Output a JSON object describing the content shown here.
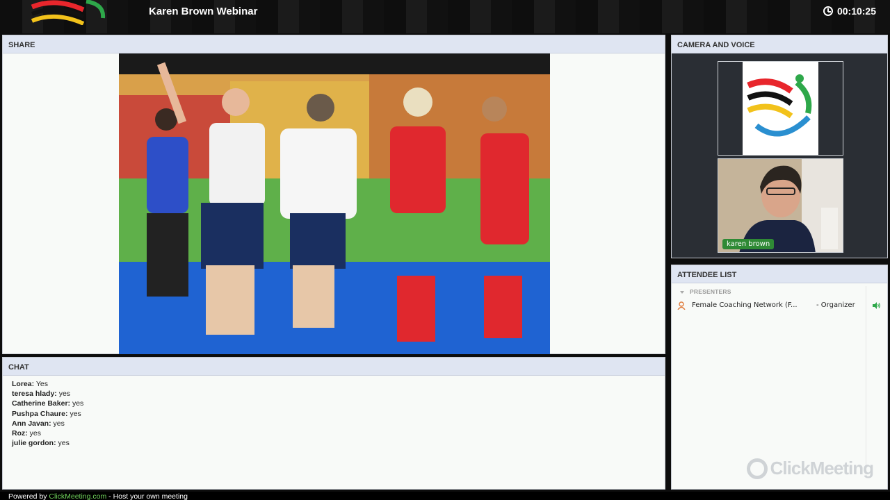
{
  "app": {
    "title": "Karen Brown Webinar",
    "timer": "00:10:25",
    "accent_color": "#6fd25b"
  },
  "share": {
    "header": "SHARE"
  },
  "chat": {
    "header": "CHAT",
    "messages": [
      {
        "name": "Lorea:",
        "text": "Yes"
      },
      {
        "name": "teresa hlady:",
        "text": "yes"
      },
      {
        "name": "Catherine Baker:",
        "text": "yes"
      },
      {
        "name": "Pushpa Chaure:",
        "text": "yes"
      },
      {
        "name": "Ann Javan:",
        "text": "yes"
      },
      {
        "name": "Roz:",
        "text": "yes"
      },
      {
        "name": "julie gordon:",
        "text": "yes"
      }
    ]
  },
  "camera": {
    "header": "CAMERA AND VOICE",
    "presenter_name": "karen brown"
  },
  "attendees": {
    "header": "ATTENDEE LIST",
    "group_label": "PRESENTERS",
    "items": [
      {
        "name": "Female Coaching Network (F...",
        "role": "- Organizer",
        "icon": "person-icon",
        "audio_icon": "speaker-icon"
      }
    ],
    "watermark": "ClickMeeting"
  },
  "footer": {
    "prefix": "Powered by",
    "link": "ClickMeeting.com",
    "suffix": " - Host your own meeting"
  }
}
